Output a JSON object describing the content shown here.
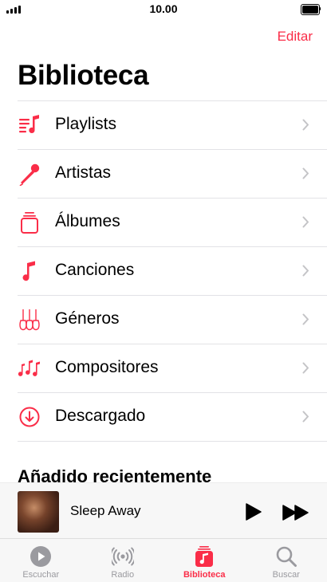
{
  "status_bar": {
    "time": "10.00"
  },
  "header": {
    "edit_label": "Editar",
    "title": "Biblioteca"
  },
  "menu": [
    {
      "label": "Playlists",
      "icon": "playlist-icon"
    },
    {
      "label": "Artistas",
      "icon": "microphone-icon"
    },
    {
      "label": "Álbumes",
      "icon": "album-stack-icon"
    },
    {
      "label": "Canciones",
      "icon": "music-note-icon"
    },
    {
      "label": "Géneros",
      "icon": "guitars-icon"
    },
    {
      "label": "Compositores",
      "icon": "composers-notes-icon"
    },
    {
      "label": "Descargado",
      "icon": "download-icon"
    }
  ],
  "recent": {
    "title": "Añadido recientemente"
  },
  "mini_player": {
    "track": "Sleep Away"
  },
  "tab_bar": [
    {
      "label": "Escuchar",
      "icon": "play-circle-icon",
      "active": false
    },
    {
      "label": "Radio",
      "icon": "radio-waves-icon",
      "active": false
    },
    {
      "label": "Biblioteca",
      "icon": "library-icon",
      "active": true
    },
    {
      "label": "Buscar",
      "icon": "search-icon",
      "active": false
    }
  ],
  "colors": {
    "accent": "#fa2d48",
    "inactive": "#9a9a9f",
    "separator": "#e2e2e6"
  }
}
